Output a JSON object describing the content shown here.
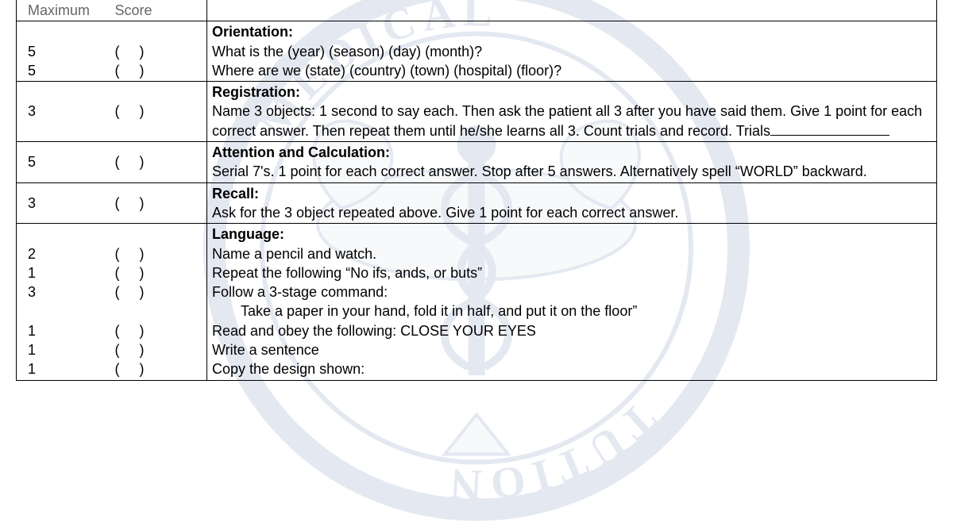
{
  "headers": {
    "maximum_fragment": "Maximum",
    "score_fragment": "Score"
  },
  "sections": [
    {
      "title": "Orientation:",
      "rows": [
        {
          "max": "5",
          "desc": "What is the (year) (season) (day) (month)?"
        },
        {
          "max": "5",
          "desc": "Where are we (state) (country) (town) (hospital) (floor)?"
        }
      ]
    },
    {
      "title": "Registration:",
      "rows": [
        {
          "max": "3",
          "desc": "Name 3 objects: 1 second to say each. Then ask the patient all 3 after you have said them. Give 1 point for each correct answer. Then repeat them until he/she learns all 3. Count trials and record.  Trials",
          "trials_blank": true
        }
      ]
    },
    {
      "title": "Attention and Calculation:",
      "rows": [
        {
          "max": "5",
          "desc": "Serial 7's. 1 point for each correct answer. Stop after 5 answers. Alternatively spell “WORLD” backward."
        }
      ]
    },
    {
      "title": "Recall:",
      "rows": [
        {
          "max": "3",
          "desc": "Ask for the 3 object repeated above. Give 1 point for each correct answer."
        }
      ]
    },
    {
      "title": "Language:",
      "rows": [
        {
          "max": "2",
          "desc": "Name a pencil and watch."
        },
        {
          "max": "1",
          "desc": "Repeat the following “No ifs, ands, or buts”"
        },
        {
          "max": "3",
          "desc": "Follow a 3-stage command:",
          "subdesc": "Take a paper in your hand, fold it in half, and put it on the floor”"
        },
        {
          "max": "1",
          "desc": "Read and obey the following: CLOSE YOUR EYES"
        },
        {
          "max": "1",
          "desc": "Write a sentence"
        },
        {
          "max": "1",
          "desc": "Copy the design shown:"
        }
      ]
    }
  ],
  "paren_open": "(",
  "paren_close": ")"
}
